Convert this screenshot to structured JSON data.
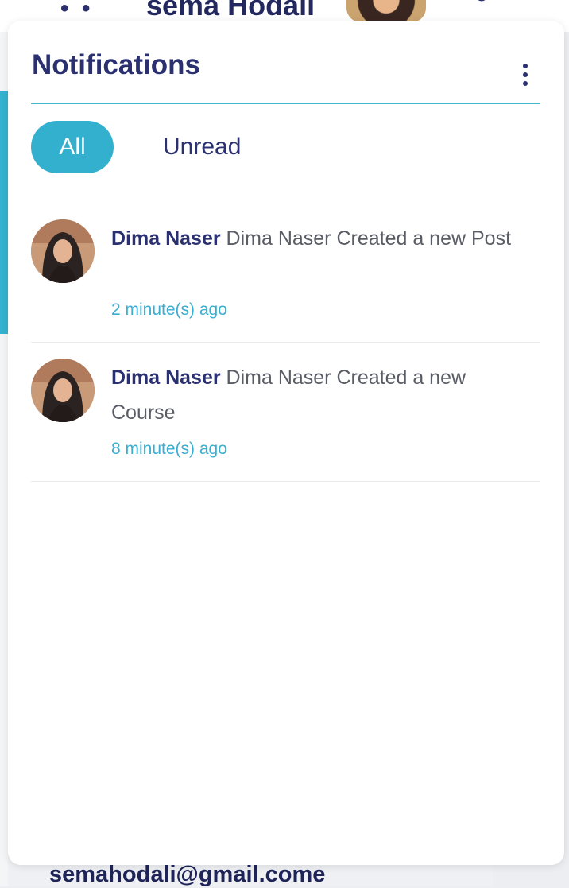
{
  "header": {
    "username": "sema Hodali",
    "more_icon": "more-dots-icon",
    "settings_icon": "settings-icon"
  },
  "panel": {
    "title": "Notifications",
    "menu_icon": "vertical-dots-icon",
    "tabs": [
      {
        "label": "All",
        "active": true
      },
      {
        "label": "Unread",
        "active": false
      }
    ],
    "notifications": [
      {
        "actor": "Dima Naser",
        "message": "Dima Naser Created a new Post",
        "time": "2 minute(s) ago"
      },
      {
        "actor": "Dima Naser",
        "message": "Dima Naser Created a new Course",
        "time": "8 minute(s) ago"
      }
    ]
  },
  "footer": {
    "email": "semahodali@gmail.come"
  },
  "colors": {
    "accent": "#33b0cd",
    "title": "#2a3070",
    "body_text": "#5a5d66",
    "timestamp": "#3aaed0"
  }
}
